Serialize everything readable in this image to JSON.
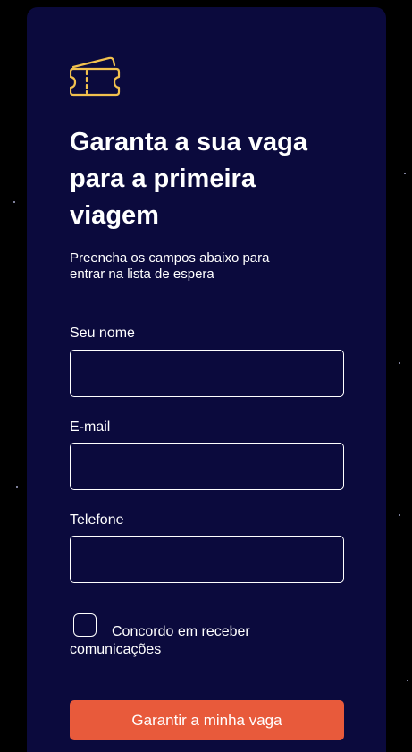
{
  "form": {
    "title": "Garanta a sua vaga para a primeira viagem",
    "subtitle": "Preencha os campos abaixo para entrar na lista de espera",
    "fields": [
      {
        "label": "Seu nome",
        "value": "",
        "placeholder": ""
      },
      {
        "label": "E-mail",
        "value": "",
        "placeholder": ""
      },
      {
        "label": "Telefone",
        "value": "",
        "placeholder": ""
      }
    ],
    "consent_label": "Concordo em receber comunicações",
    "consent_checked": false,
    "submit_label": "Garantir a minha vaga"
  },
  "colors": {
    "page_background": "#000000",
    "card_background": "#0b0a3d",
    "accent": "#e85a3b",
    "icon_gold": "#f2c14e",
    "text": "#ffffff"
  },
  "icons": {
    "header_icon": "ticket-icon"
  }
}
